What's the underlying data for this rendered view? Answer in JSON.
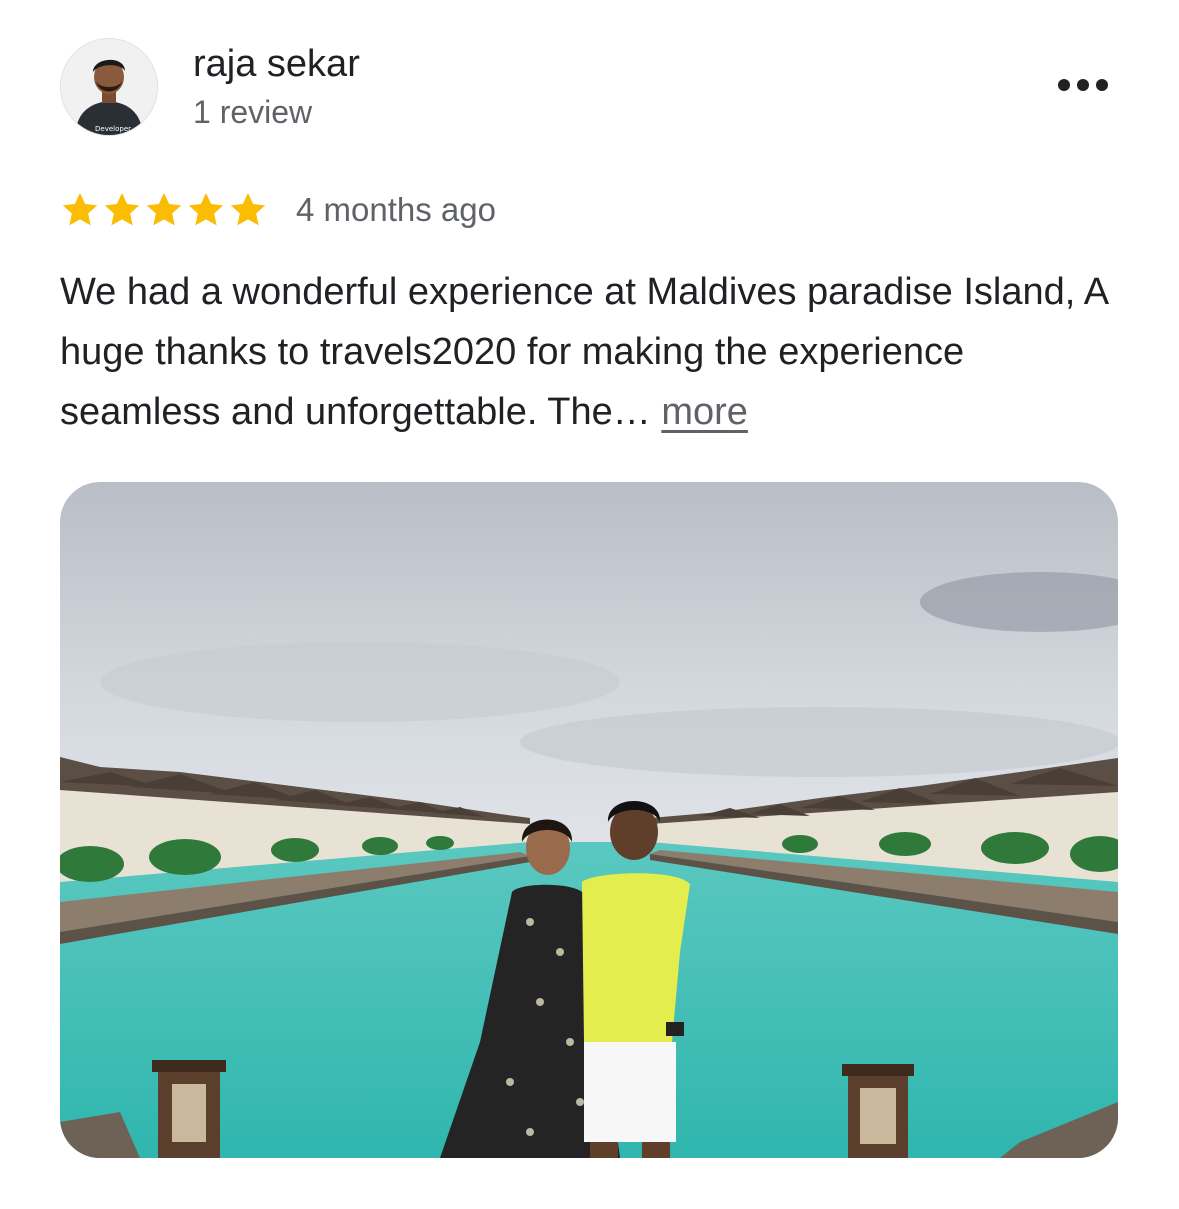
{
  "review": {
    "author_name": "raja sekar",
    "review_count": "1 review",
    "avatar_text": "Developer",
    "rating": 5,
    "rating_max": 5,
    "date": "4 months ago",
    "text": "We had a wonderful experience at Maldives paradise Island, A huge thanks to travels2020 for making the experience seamless and unforgettable. The…",
    "more_label": "more"
  },
  "icons": {
    "menu": "more-horizontal-icon",
    "star": "star-icon"
  },
  "colors": {
    "star": "#FBBC04",
    "primary_text": "#202124",
    "secondary_text": "#5F6368",
    "water": "#3FBFB6"
  }
}
